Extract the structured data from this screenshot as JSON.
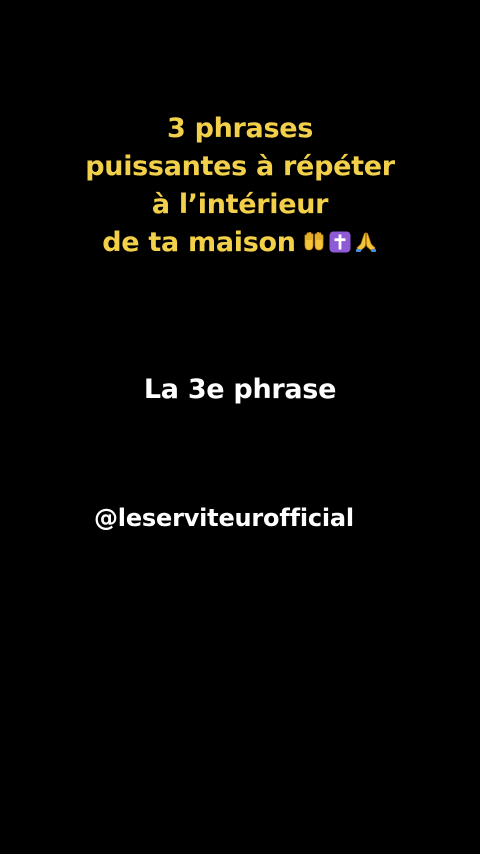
{
  "caption": {
    "lines": [
      "3 phrases",
      "puissantes à répéter",
      "à l’intérieur",
      "de ta maison"
    ],
    "emojis": [
      "raised-hands-icon",
      "latin-cross-icon",
      "praying-hands-icon"
    ],
    "color": "#f2d04a"
  },
  "subtitle": "La 3e phrase",
  "handle": "@leserviteurofficial",
  "background": "#000000"
}
